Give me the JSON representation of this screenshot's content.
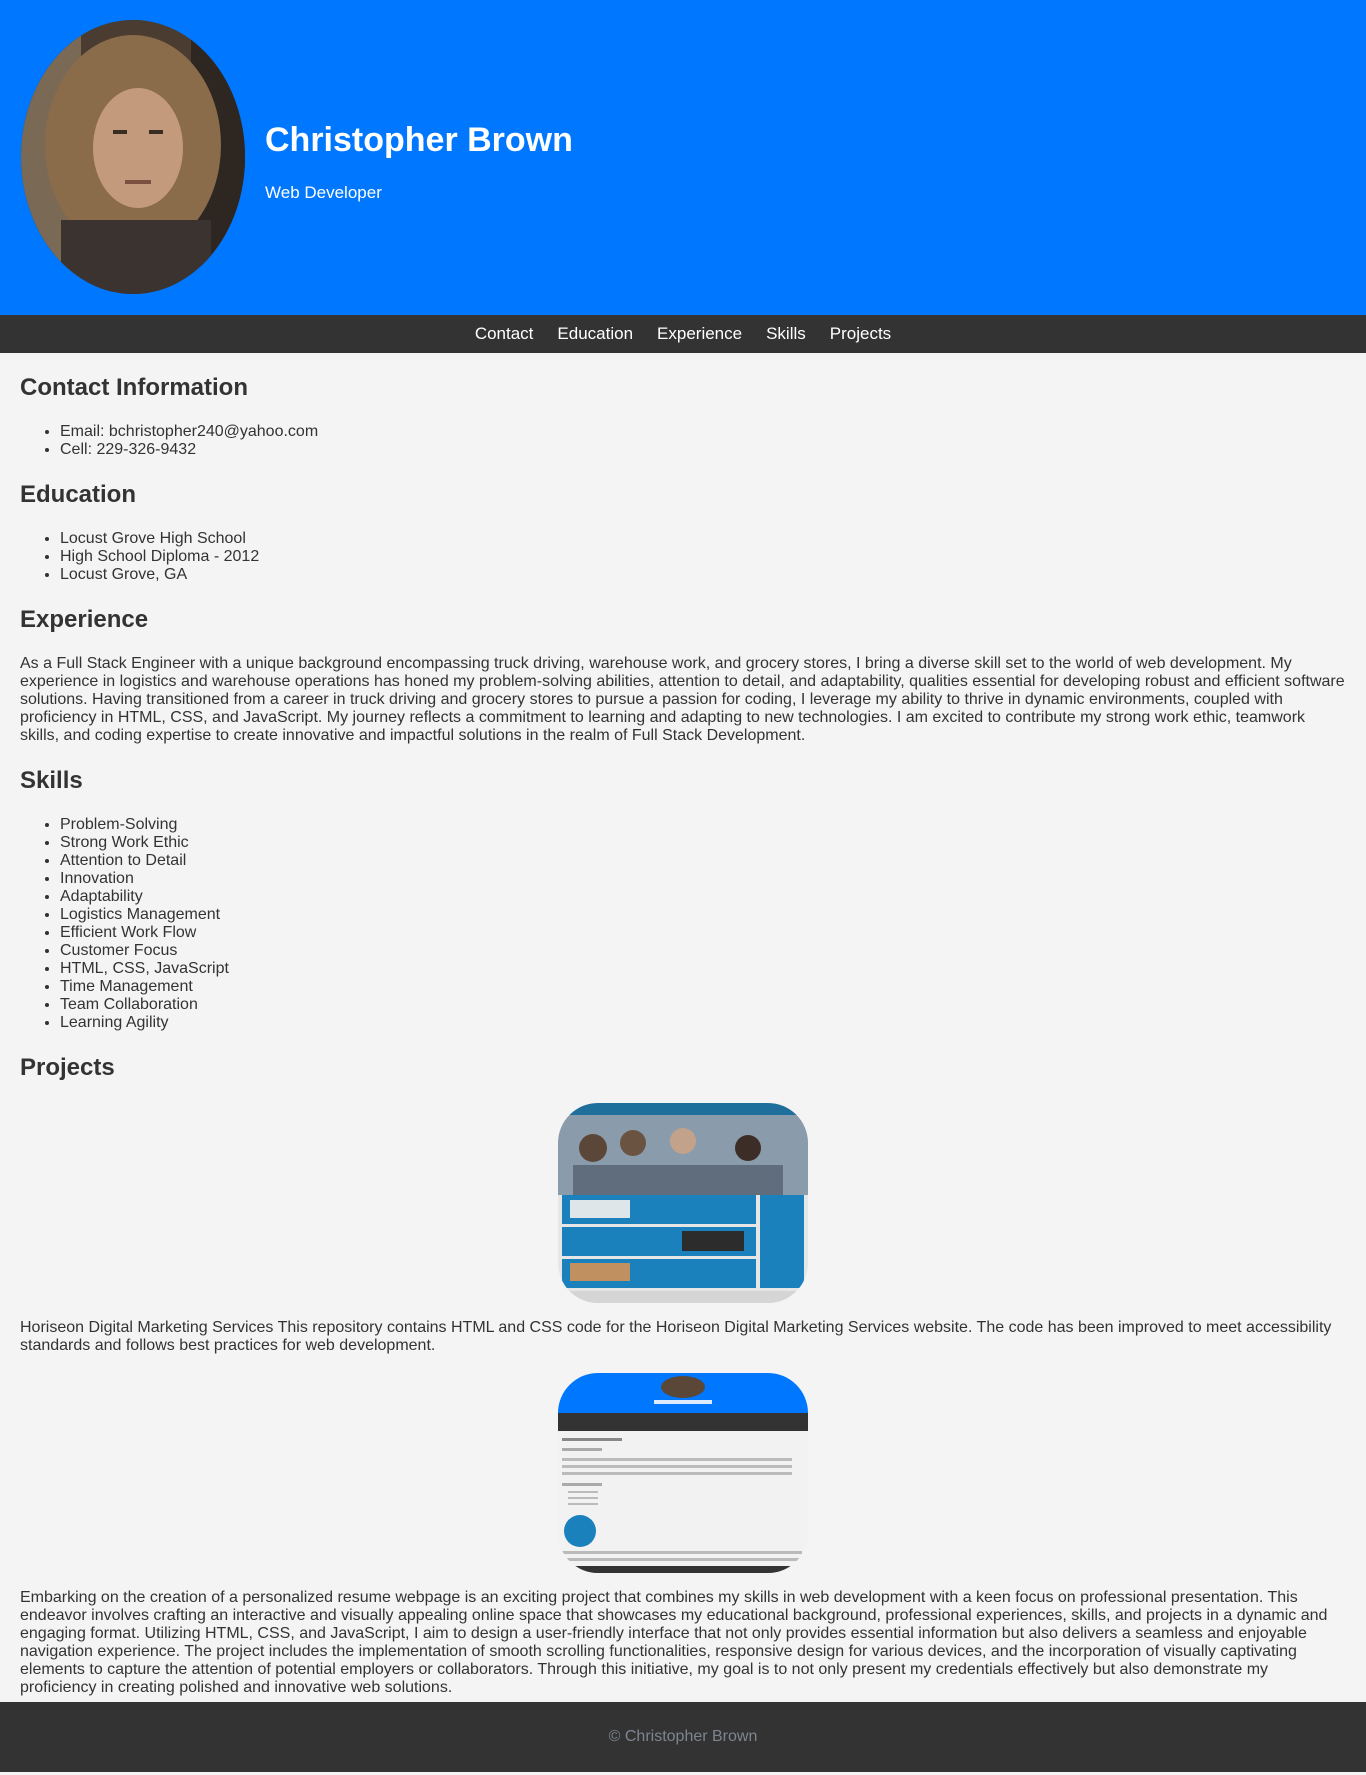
{
  "header": {
    "name": "Christopher Brown",
    "role": "Web Developer",
    "background_color": "#0077ff"
  },
  "nav": {
    "items": [
      "Contact",
      "Education",
      "Experience",
      "Skills",
      "Projects"
    ]
  },
  "contact": {
    "title": "Contact Information",
    "items": [
      "Email: bchristopher240@yahoo.com",
      "Cell: 229-326-9432"
    ]
  },
  "education": {
    "title": "Education",
    "items": [
      "Locust Grove High School",
      "High School Diploma - 2012",
      "Locust Grove, GA"
    ]
  },
  "experience": {
    "title": "Experience",
    "text": "As a Full Stack Engineer with a unique background encompassing truck driving, warehouse work, and grocery stores, I bring a diverse skill set to the world of web development. My experience in logistics and warehouse operations has honed my problem-solving abilities, attention to detail, and adaptability, qualities essential for developing robust and efficient software solutions. Having transitioned from a career in truck driving and grocery stores to pursue a passion for coding, I leverage my ability to thrive in dynamic environments, coupled with proficiency in HTML, CSS, and JavaScript. My journey reflects a commitment to learning and adapting to new technologies. I am excited to contribute my strong work ethic, teamwork skills, and coding expertise to create innovative and impactful solutions in the realm of Full Stack Development."
  },
  "skills": {
    "title": "Skills",
    "items": [
      "Problem-Solving",
      "Strong Work Ethic",
      "Attention to Detail",
      "Innovation",
      "Adaptability",
      "Logistics Management",
      "Efficient Work Flow",
      "Customer Focus",
      "HTML, CSS, JavaScript",
      "Time Management",
      "Team Collaboration",
      "Learning Agility"
    ]
  },
  "projects": {
    "title": "Projects",
    "items": [
      {
        "text": "Horiseon Digital Marketing Services This repository contains HTML and CSS code for the Horiseon Digital Marketing Services website. The code has been improved to meet accessibility standards and follows best practices for web development."
      },
      {
        "text": "Embarking on the creation of a personalized resume webpage is an exciting project that combines my skills in web development with a keen focus on professional presentation. This endeavor involves crafting an interactive and visually appealing online space that showcases my educational background, professional experiences, skills, and projects in a dynamic and engaging format. Utilizing HTML, CSS, and JavaScript, I aim to design a user-friendly interface that not only provides essential information but also delivers a seamless and enjoyable navigation experience. The project includes the implementation of smooth scrolling functionalities, responsive design for various devices, and the incorporation of visually captivating elements to capture the attention of potential employers or collaborators. Through this initiative, my goal is to not only present my credentials effectively but also demonstrate my proficiency in creating polished and innovative web solutions."
      }
    ]
  },
  "footer": {
    "text": "© Christopher Brown"
  }
}
